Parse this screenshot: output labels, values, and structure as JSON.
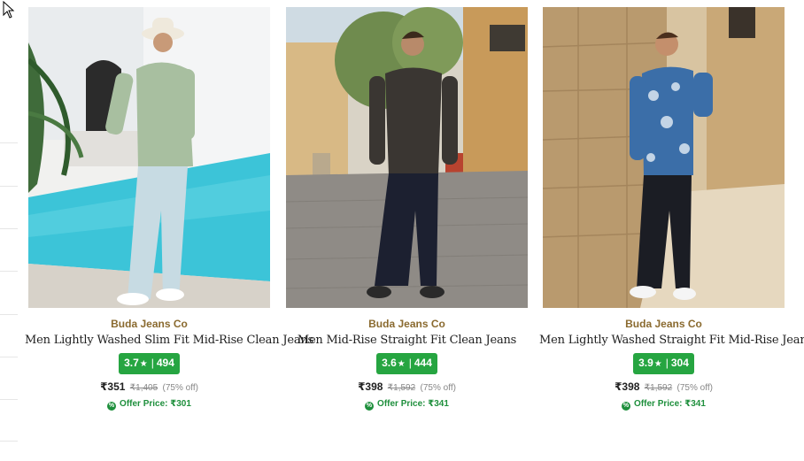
{
  "products": [
    {
      "brand": "Buda Jeans Co",
      "title": "Men Lightly Washed Slim Fit Mid-Rise Clean Jeans",
      "rating": "3.7",
      "rating_count": "494",
      "price": "₹351",
      "mrp": "₹1,405",
      "discount": "(75% off)",
      "offer_price": "Offer Price: ₹301",
      "image_scene": "poolside-man-green-shirt-light-jeans"
    },
    {
      "brand": "Buda Jeans Co",
      "title": "Men Mid-Rise Straight Fit Clean Jeans",
      "rating": "3.6",
      "rating_count": "444",
      "price": "₹398",
      "mrp": "₹1,592",
      "discount": "(75% off)",
      "offer_price": "Offer Price: ₹341",
      "image_scene": "street-man-black-shirt-dark-jeans"
    },
    {
      "brand": "Buda Jeans Co",
      "title": "Men Lightly Washed Straight Fit Mid-Rise Jeans",
      "rating": "3.9",
      "rating_count": "304",
      "price": "₹398",
      "mrp": "₹1,592",
      "discount": "(75% off)",
      "offer_price": "Offer Price: ₹341",
      "image_scene": "stone-wall-man-floral-shirt-black-jeans"
    }
  ],
  "colors": {
    "rating_badge": "#26a541",
    "brand_text": "#8a6a2f",
    "offer_text": "#1e8f3c"
  },
  "icons": {
    "star": "★",
    "offer": "%"
  }
}
